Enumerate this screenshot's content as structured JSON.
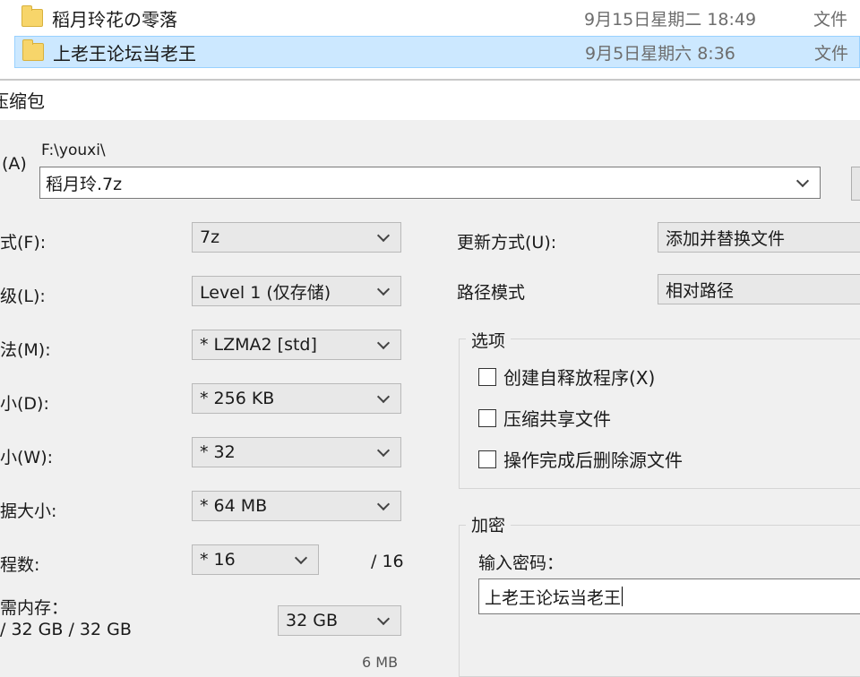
{
  "explorer": {
    "rows": [
      {
        "name": "稻月玲花の零落",
        "date": "9月15日星期二 18:49",
        "type": "文件"
      },
      {
        "name": "上老王论坛当老王",
        "date": "9月5日星期六 8:36",
        "type": "文件"
      }
    ]
  },
  "dialog": {
    "title": "压缩包",
    "archive": {
      "label": "(A)",
      "path": "F:\\youxi\\",
      "name": "稻月玲.7z"
    },
    "left": {
      "format": {
        "label": "式(F):",
        "value": "7z"
      },
      "level": {
        "label": "级(L):",
        "value": "Level 1 (仅存储)"
      },
      "method": {
        "label": "法(M):",
        "value": "* LZMA2 [std]"
      },
      "dict": {
        "label": "小(D):",
        "value": "* 256 KB"
      },
      "word": {
        "label": "小(W):",
        "value": "* 32"
      },
      "solid": {
        "label": "据大小:",
        "value": "* 64 MB"
      },
      "threads": {
        "label": "程数:",
        "value": "* 16",
        "max": "/ 16"
      },
      "memory": {
        "label": "需内存：",
        "usage": "/ 32 GB / 32 GB",
        "value": "32 GB"
      },
      "bottom_cut": "6 MB"
    },
    "right": {
      "update": {
        "label": "更新方式(U):",
        "value": "添加并替换文件"
      },
      "pathmode": {
        "label": "路径模式",
        "value": "相对路径"
      },
      "options": {
        "title": "选项",
        "items": [
          "创建自释放程序(X)",
          "压缩共享文件",
          "操作完成后删除源文件"
        ]
      },
      "encryption": {
        "title": "加密",
        "password_label": "输入密码：",
        "password_value": "上老王论坛当老王"
      }
    }
  }
}
